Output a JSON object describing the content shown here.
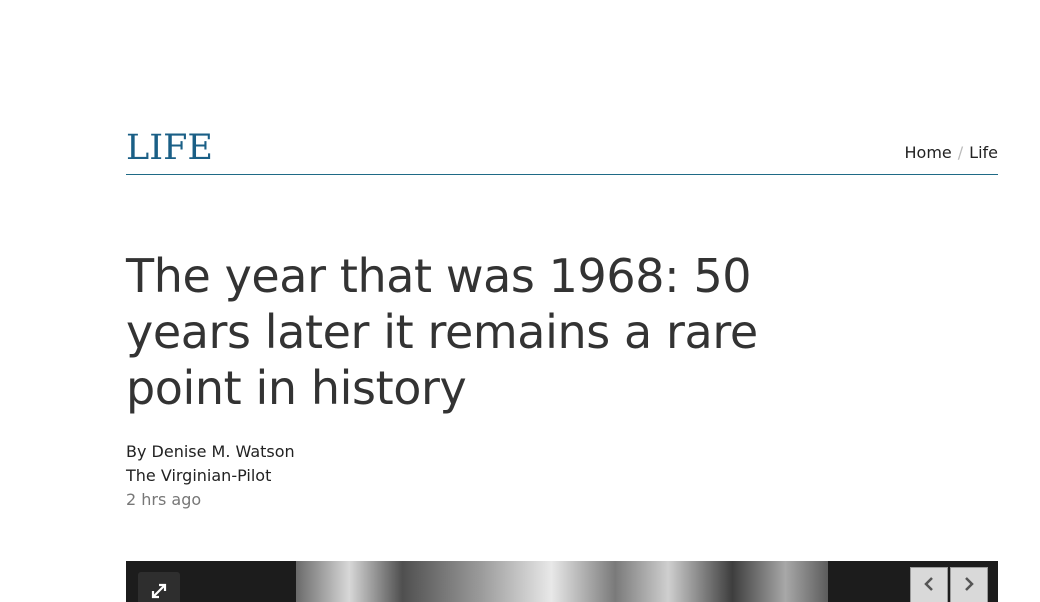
{
  "section": {
    "title": "LIFE",
    "accent_color": "#1a5f86"
  },
  "breadcrumb": {
    "home": "Home",
    "separator": "/",
    "current": "Life"
  },
  "article": {
    "headline": "The year that was 1968: 50 years later it remains a rare point in history",
    "byline": "By Denise M. Watson",
    "publication": "The Virginian-Pilot",
    "timestamp": "2 hrs ago"
  },
  "gallery": {
    "expand_icon": "expand-icon",
    "prev_icon": "chevron-left-icon",
    "next_icon": "chevron-right-icon"
  }
}
